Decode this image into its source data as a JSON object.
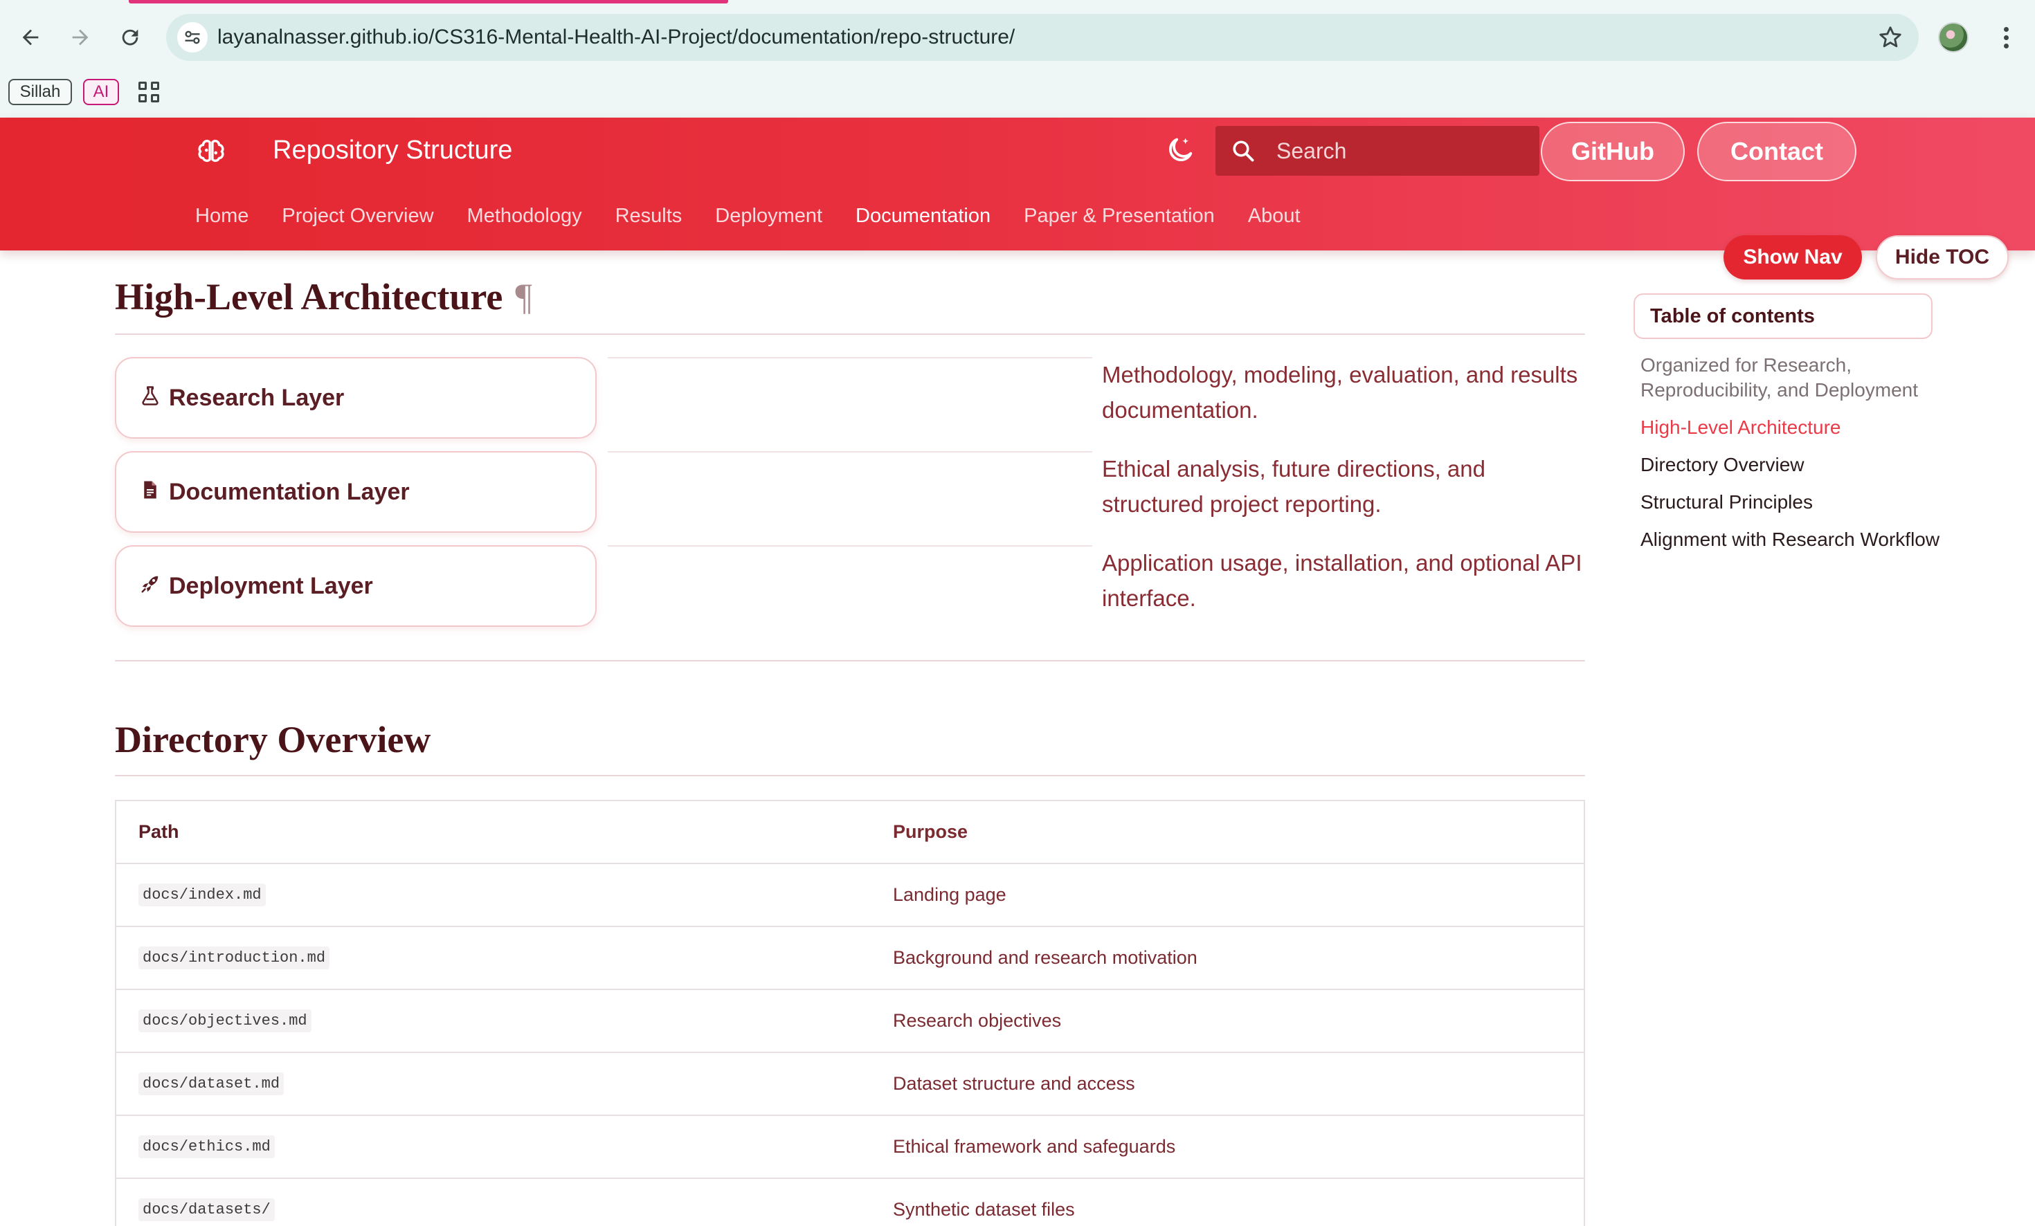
{
  "browser": {
    "url": "layanalnasser.github.io/CS316-Mental-Health-AI-Project/documentation/repo-structure/",
    "bookmarks": [
      "Sillah",
      "AI"
    ]
  },
  "header": {
    "title": "Repository Structure",
    "search_placeholder": "Search",
    "github_label": "GitHub",
    "contact_label": "Contact",
    "tabs": [
      {
        "label": "Home"
      },
      {
        "label": "Project Overview"
      },
      {
        "label": "Methodology"
      },
      {
        "label": "Results"
      },
      {
        "label": "Deployment"
      },
      {
        "label": "Documentation",
        "active": true
      },
      {
        "label": "Paper & Presentation"
      },
      {
        "label": "About"
      }
    ],
    "colors": {
      "primary": "#e3262f",
      "accent": "#f04a63"
    }
  },
  "toggles": {
    "show_nav": "Show Nav",
    "hide_toc": "Hide TOC"
  },
  "architecture": {
    "heading": "High-Level Architecture",
    "anchor": "¶",
    "layers": [
      {
        "name": "Research Layer",
        "icon": "flask-icon",
        "description": "Methodology, modeling, evaluation, and results documentation."
      },
      {
        "name": "Documentation Layer",
        "icon": "document-icon",
        "description": "Ethical analysis, future directions, and structured project reporting."
      },
      {
        "name": "Deployment Layer",
        "icon": "rocket-icon",
        "description": "Application usage, installation, and optional API interface."
      }
    ]
  },
  "directory": {
    "heading": "Directory Overview",
    "columns": [
      "Path",
      "Purpose"
    ],
    "rows": [
      {
        "path": "docs/index.md",
        "purpose": "Landing page"
      },
      {
        "path": "docs/introduction.md",
        "purpose": "Background and research motivation"
      },
      {
        "path": "docs/objectives.md",
        "purpose": "Research objectives"
      },
      {
        "path": "docs/dataset.md",
        "purpose": "Dataset structure and access"
      },
      {
        "path": "docs/ethics.md",
        "purpose": "Ethical framework and safeguards"
      },
      {
        "path": "docs/datasets/",
        "purpose": "Synthetic dataset files"
      }
    ]
  },
  "toc": {
    "title": "Table of contents",
    "items": [
      {
        "label": "Organized for Research, Reproducibility, and Deployment",
        "state": "muted"
      },
      {
        "label": "High-Level Architecture",
        "state": "active"
      },
      {
        "label": "Directory Overview",
        "state": "normal"
      },
      {
        "label": "Structural Principles",
        "state": "normal"
      },
      {
        "label": "Alignment with Research Workflow",
        "state": "normal"
      }
    ]
  }
}
